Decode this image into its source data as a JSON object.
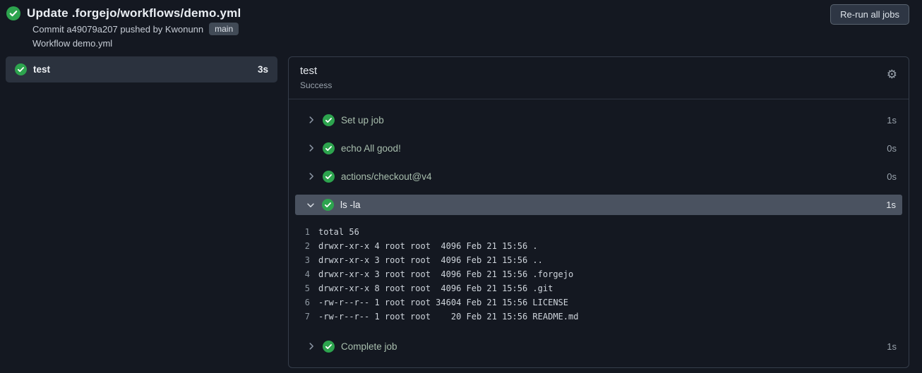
{
  "colors": {
    "success_green": "#2da44e",
    "page_bg": "#141821",
    "highlight_row": "#4a5260"
  },
  "icons": {
    "gear": "⚙",
    "success": "check-circle"
  },
  "header": {
    "title": "Update .forgejo/workflows/demo.yml",
    "commit_prefix": "Commit ",
    "commit_sha": "a49079a207",
    "commit_middle": " pushed by ",
    "commit_author": "Kwonunn",
    "branch": "main",
    "workflow_line": "Workflow demo.yml",
    "rerun_button": "Re-run all jobs"
  },
  "sidebar": {
    "jobs": [
      {
        "name": "test",
        "duration": "3s",
        "status": "success",
        "selected": true
      }
    ]
  },
  "job_panel": {
    "title": "test",
    "status": "Success",
    "steps": [
      {
        "name": "Set up job",
        "duration": "1s",
        "status": "success",
        "expanded": false
      },
      {
        "name": "echo All good!",
        "duration": "0s",
        "status": "success",
        "expanded": false
      },
      {
        "name": "actions/checkout@v4",
        "duration": "0s",
        "status": "success",
        "expanded": false
      },
      {
        "name": "ls -la",
        "duration": "1s",
        "status": "success",
        "expanded": true,
        "logs": [
          {
            "num": "1",
            "text": "total 56"
          },
          {
            "num": "2",
            "text": "drwxr-xr-x 4 root root  4096 Feb 21 15:56 ."
          },
          {
            "num": "3",
            "text": "drwxr-xr-x 3 root root  4096 Feb 21 15:56 .."
          },
          {
            "num": "4",
            "text": "drwxr-xr-x 3 root root  4096 Feb 21 15:56 .forgejo"
          },
          {
            "num": "5",
            "text": "drwxr-xr-x 8 root root  4096 Feb 21 15:56 .git"
          },
          {
            "num": "6",
            "text": "-rw-r--r-- 1 root root 34604 Feb 21 15:56 LICENSE"
          },
          {
            "num": "7",
            "text": "-rw-r--r-- 1 root root    20 Feb 21 15:56 README.md"
          }
        ]
      },
      {
        "name": "Complete job",
        "duration": "1s",
        "status": "success",
        "expanded": false
      }
    ]
  }
}
